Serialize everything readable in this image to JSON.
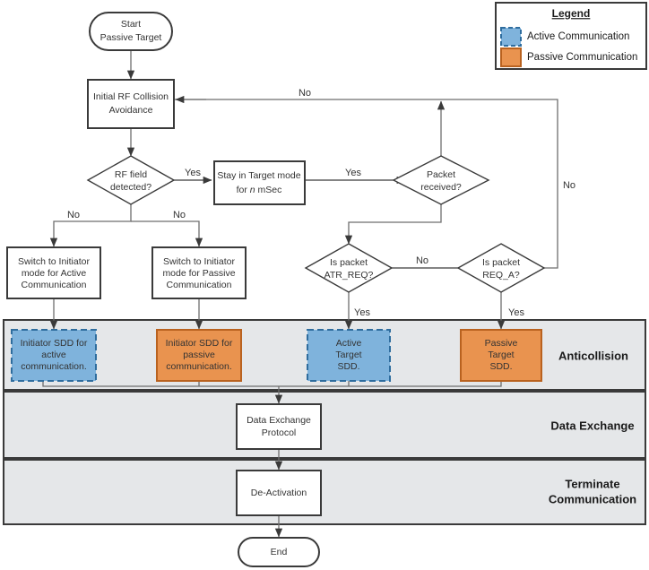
{
  "legend": {
    "title": "Legend",
    "items": [
      {
        "label": "Active Communication",
        "color": "#7fb3dc",
        "border": "#2f6d9e",
        "style": "dashed"
      },
      {
        "label": "Passive Communication",
        "color": "#e9934f",
        "border": "#b9621f",
        "style": "solid"
      }
    ]
  },
  "nodes": {
    "start": "Start\nPassive Target",
    "start_line1": "Start",
    "start_line2": "Passive Target",
    "initial_rf_line1": "Initial RF Collision",
    "initial_rf_line2": "Avoidance",
    "rf_field_line1": "RF field",
    "rf_field_line2": "detected?",
    "stay_target_line1": "Stay in Target mode",
    "stay_target_line2_pre": "for ",
    "stay_target_line2_italic": "n",
    "stay_target_line2_post": " mSec",
    "packet_received_line1": "Packet",
    "packet_received_line2": "received?",
    "switch_active_line1": "Switch to Initiator",
    "switch_active_line2": "mode for Active",
    "switch_active_line3": "Communication",
    "switch_passive_line1": "Switch to Initiator",
    "switch_passive_line2": "mode for Passive",
    "switch_passive_line3": "Communication",
    "is_atr_line1": "Is packet",
    "is_atr_line2": "ATR_REQ?",
    "is_reqa_line1": "Is packet",
    "is_reqa_line2": "REQ_A?",
    "initiator_sdd_active_line1": "Initiator SDD for",
    "initiator_sdd_active_line2": "active",
    "initiator_sdd_active_line3": "communication.",
    "initiator_sdd_passive_line1": "Initiator SDD for",
    "initiator_sdd_passive_line2": "passive",
    "initiator_sdd_passive_line3": "communication.",
    "active_target_sdd_line1": "Active",
    "active_target_sdd_line2": "Target",
    "active_target_sdd_line3": "SDD.",
    "passive_target_sdd_line1": "Passive",
    "passive_target_sdd_line2": "Target",
    "passive_target_sdd_line3": "SDD.",
    "data_exchange_line1": "Data Exchange",
    "data_exchange_line2": "Protocol",
    "deactivation": "De-Activation",
    "end": "End"
  },
  "edge_labels": {
    "rf_yes": "Yes",
    "rf_no_left": "No",
    "rf_no_right": "No",
    "packet_received_no_top": "No",
    "stay_yes": "Yes",
    "atr_no": "No",
    "atr_yes": "Yes",
    "reqa_yes": "Yes",
    "reqa_no_right": "No"
  },
  "bands": [
    {
      "label": "Anticollision",
      "label_line1": "Anticollision",
      "label_line2": ""
    },
    {
      "label": "Data Exchange",
      "label_line1": "Data Exchange",
      "label_line2": ""
    },
    {
      "label": "Terminate Communication",
      "label_line1": "Terminate",
      "label_line2": "Communication"
    }
  ],
  "colors": {
    "band_fill": "#e5e7e9",
    "stroke": "#3a3a3a",
    "connector": "#6e6e6e",
    "active_blue": "#7fb3dc",
    "active_blue_border": "#2f6d9e",
    "passive_orange": "#e9934f",
    "passive_orange_border": "#b9621f"
  }
}
